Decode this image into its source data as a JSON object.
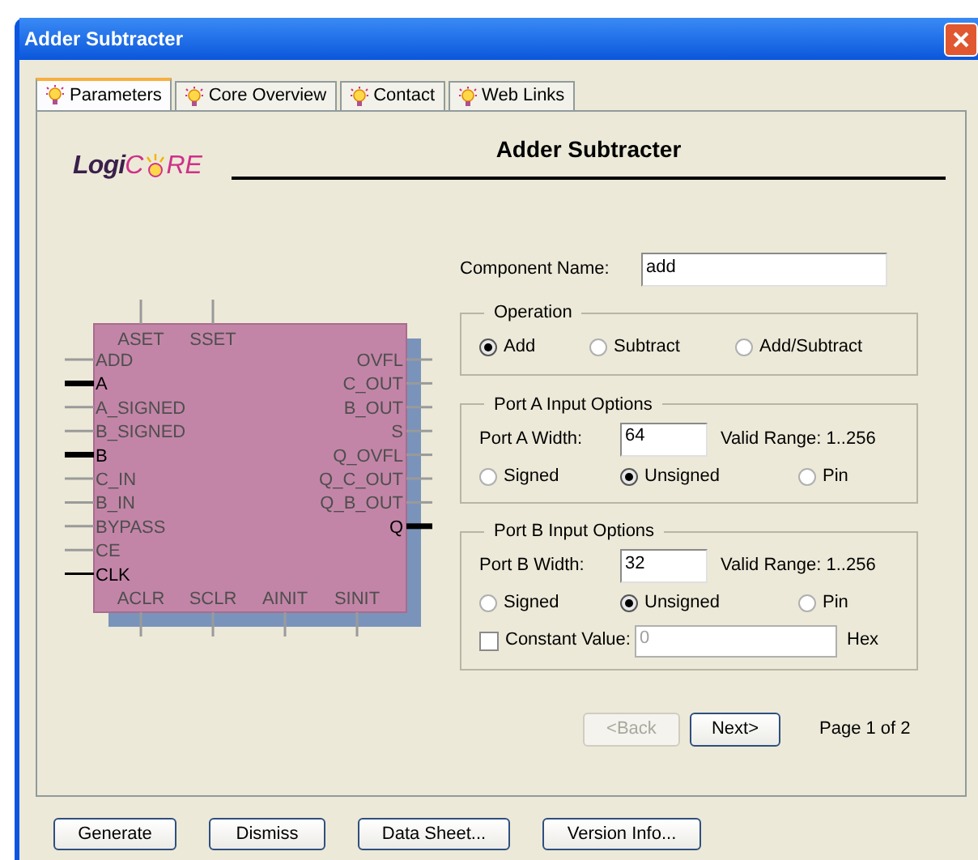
{
  "window": {
    "title": "Adder Subtracter"
  },
  "tabs": [
    {
      "label": "Parameters",
      "selected": true
    },
    {
      "label": "Core Overview",
      "selected": false
    },
    {
      "label": "Contact",
      "selected": false
    },
    {
      "label": "Web Links",
      "selected": false
    }
  ],
  "logo": {
    "parts": [
      "Logi",
      "C",
      "RE"
    ]
  },
  "heading": "Adder Subtracter",
  "symbol": {
    "top_pins": [
      {
        "label": "ASET",
        "kind": "unused"
      },
      {
        "label": "SSET",
        "kind": "unused"
      }
    ],
    "left_pins": [
      {
        "label": "ADD",
        "kind": "unused"
      },
      {
        "label": "A",
        "kind": "bus"
      },
      {
        "label": "A_SIGNED",
        "kind": "unused"
      },
      {
        "label": "B_SIGNED",
        "kind": "unused"
      },
      {
        "label": "B",
        "kind": "bus"
      },
      {
        "label": "C_IN",
        "kind": "unused"
      },
      {
        "label": "B_IN",
        "kind": "unused"
      },
      {
        "label": "BYPASS",
        "kind": "unused"
      },
      {
        "label": "CE",
        "kind": "unused"
      },
      {
        "label": "CLK",
        "kind": "signal"
      }
    ],
    "right_pins": [
      {
        "label": "OVFL",
        "kind": "unused"
      },
      {
        "label": "C_OUT",
        "kind": "unused"
      },
      {
        "label": "B_OUT",
        "kind": "unused"
      },
      {
        "label": "S",
        "kind": "unused"
      },
      {
        "label": "Q_OVFL",
        "kind": "unused"
      },
      {
        "label": "Q_C_OUT",
        "kind": "unused"
      },
      {
        "label": "Q_B_OUT",
        "kind": "unused"
      },
      {
        "label": "Q",
        "kind": "bus"
      }
    ],
    "bottom_pins": [
      {
        "label": "ACLR",
        "kind": "unused"
      },
      {
        "label": "SCLR",
        "kind": "unused"
      },
      {
        "label": "AINIT",
        "kind": "unused"
      },
      {
        "label": "SINIT",
        "kind": "unused"
      }
    ]
  },
  "component_name": {
    "label": "Component Name:",
    "value": "add"
  },
  "operation": {
    "title": "Operation",
    "options": [
      {
        "label": "Add",
        "selected": true
      },
      {
        "label": "Subtract",
        "selected": false
      },
      {
        "label": "Add/Subtract",
        "selected": false
      }
    ]
  },
  "port_a": {
    "title": "Port A Input Options",
    "width_label": "Port A Width:",
    "width_value": "64",
    "range": "Valid Range: 1..256",
    "options": [
      {
        "label": "Signed",
        "selected": false
      },
      {
        "label": "Unsigned",
        "selected": true
      },
      {
        "label": "Pin",
        "selected": false
      }
    ]
  },
  "port_b": {
    "title": "Port B Input Options",
    "width_label": "Port B Width:",
    "width_value": "32",
    "range": "Valid Range: 1..256",
    "options": [
      {
        "label": "Signed",
        "selected": false
      },
      {
        "label": "Unsigned",
        "selected": true
      },
      {
        "label": "Pin",
        "selected": false
      }
    ],
    "constant": {
      "label": "Constant Value:",
      "checked": false,
      "value": "0",
      "unit": "Hex"
    }
  },
  "nav": {
    "back": {
      "label": "<Back",
      "disabled": true
    },
    "next": {
      "label": "Next>",
      "disabled": false
    },
    "page": "Page 1 of 2"
  },
  "buttons": [
    "Generate",
    "Dismiss",
    "Data Sheet...",
    "Version Info..."
  ]
}
